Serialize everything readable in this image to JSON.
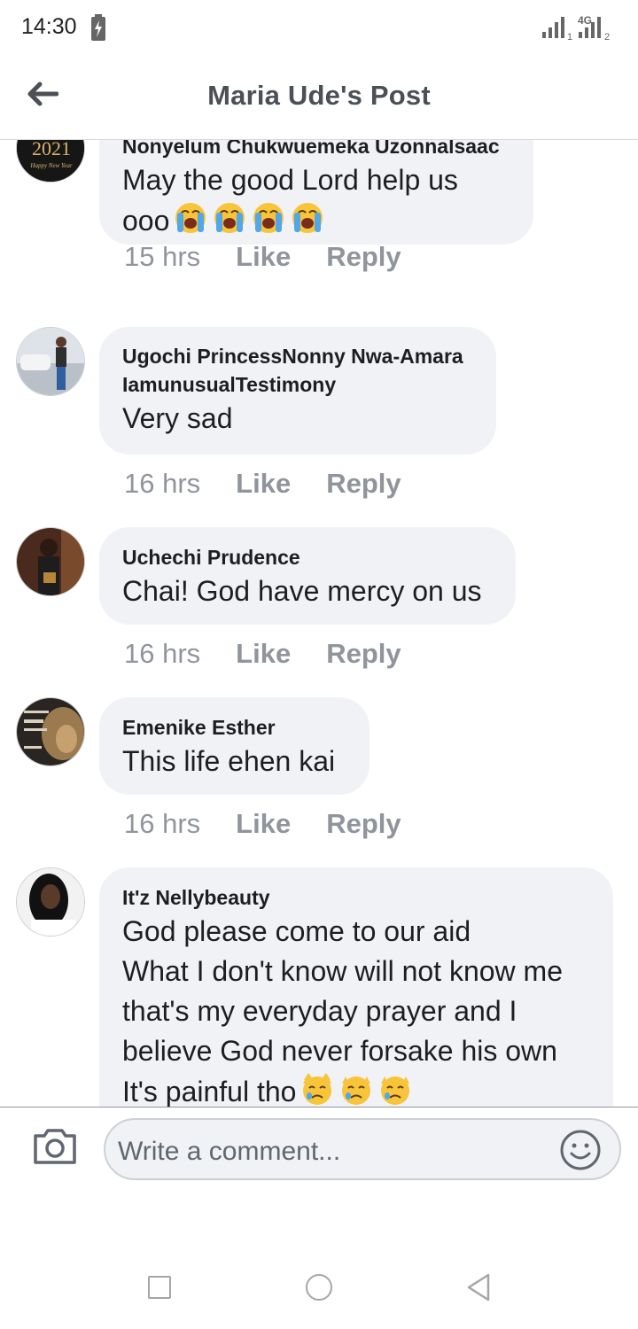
{
  "status_bar": {
    "time": "14:30",
    "network": "4G",
    "sim1": "1",
    "sim2": "2"
  },
  "header": {
    "title": "Maria Ude's Post"
  },
  "comments": [
    {
      "author": "Nonyelum Chukwuemeka Uzonnalsaac",
      "text_lines": [
        "May the good Lord help us",
        "ooo"
      ],
      "time": "15 hrs",
      "like": "Like",
      "reply": "Reply",
      "avatar_text": "2021",
      "avatar_subtext": "Happy New Year"
    },
    {
      "author_lines": [
        "Ugochi PrincessNonny Nwa-Amara",
        "IamunusualTestimony"
      ],
      "text": "Very sad",
      "time": "16 hrs",
      "like": "Like",
      "reply": "Reply"
    },
    {
      "author": "Uchechi Prudence",
      "text": "Chai! God have mercy on us",
      "time": "16 hrs",
      "like": "Like",
      "reply": "Reply"
    },
    {
      "author": "Emenike Esther",
      "text": "This life ehen kai",
      "time": "16 hrs",
      "like": "Like",
      "reply": "Reply"
    },
    {
      "author": "It'z Nellybeauty",
      "text_lines": [
        "God please come to our aid",
        "What I don't know will not know me",
        "that's my everyday prayer and I",
        "believe God never forsake his own",
        "It's painful tho"
      ]
    }
  ],
  "composer": {
    "placeholder": "Write a comment..."
  },
  "icons": {
    "crying": "loudly-crying-face-icon",
    "crying_cat": "crying-cat-icon"
  }
}
